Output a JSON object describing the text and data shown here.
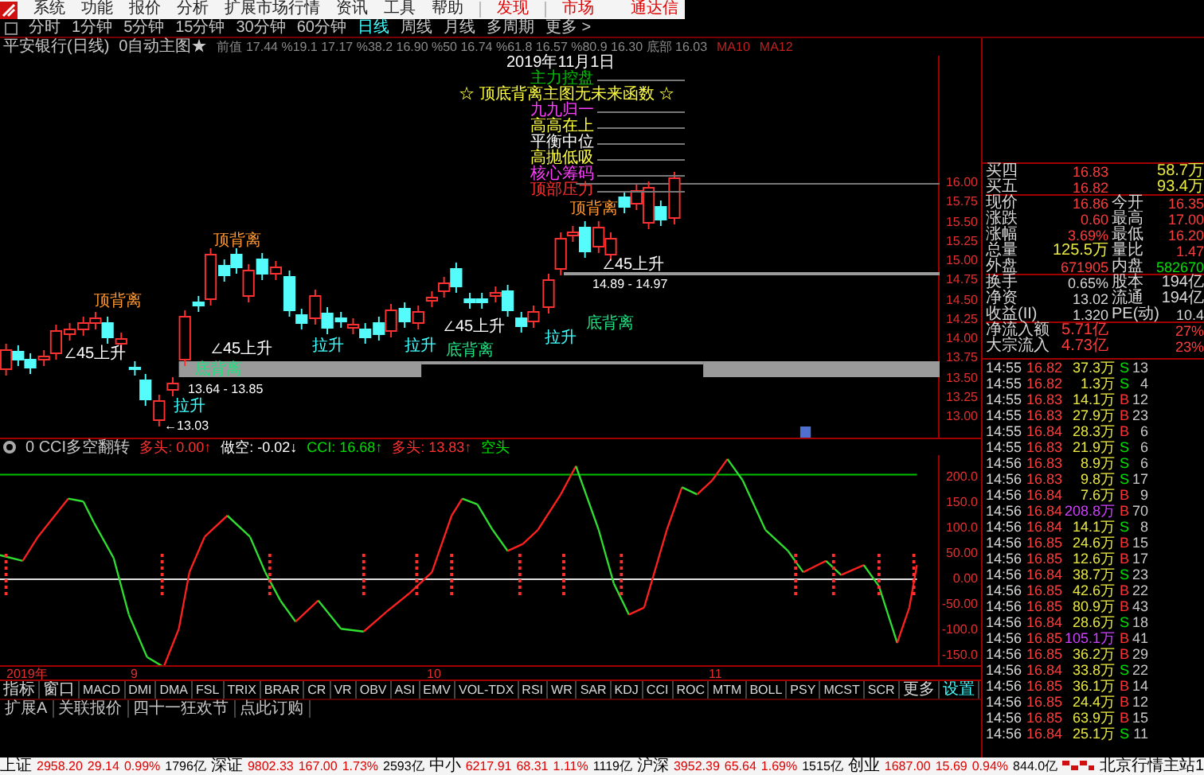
{
  "menu": {
    "items": [
      "系统",
      "功能",
      "报价",
      "分析",
      "扩展市场行情",
      "资讯",
      "工具",
      "帮助"
    ],
    "links": [
      "发现",
      "市场"
    ],
    "brand": "通达信"
  },
  "periods": [
    {
      "label": "分时",
      "selected": false
    },
    {
      "label": "1分钟",
      "selected": false
    },
    {
      "label": "5分钟",
      "selected": false
    },
    {
      "label": "15分钟",
      "selected": false
    },
    {
      "label": "30分钟",
      "selected": false
    },
    {
      "label": "60分钟",
      "selected": false
    },
    {
      "label": "日线",
      "selected": true
    },
    {
      "label": "周线",
      "selected": false
    },
    {
      "label": "月线",
      "selected": false
    },
    {
      "label": "多周期",
      "selected": false
    },
    {
      "label": "更多 >",
      "selected": false
    }
  ],
  "chart_header": {
    "title": "平安银行(日线)",
    "formula": "0自动主图★",
    "levels": "前值 17.44 %19.1 17.17 %38.2 16.90 %50 16.74 %61.8 16.57 %80.9 16.30 底部 16.03",
    "ma": [
      "MA10",
      "MA12"
    ]
  },
  "annotations": [
    {
      "text": "2019年11月1日",
      "color": "#ffffff"
    },
    {
      "text": "主力控盘",
      "color": "#00c000"
    },
    {
      "text": "☆ 顶底背离主图无未来函数 ☆",
      "color": "#ffff40"
    },
    {
      "text": "九九归一",
      "color": "#ff40ff"
    },
    {
      "text": "高高在上",
      "color": "#ffff40"
    },
    {
      "text": "平衡中位",
      "color": "#ffffff"
    },
    {
      "text": "高抛低吸",
      "color": "#ffff40"
    },
    {
      "text": "核心筹码",
      "color": "#ff40ff"
    },
    {
      "text": "顶部压力",
      "color": "#ff3030"
    }
  ],
  "chart_marks": [
    {
      "text": "顶背离",
      "kind": "top"
    },
    {
      "text": "顶背离",
      "kind": "top"
    },
    {
      "text": "顶背离",
      "kind": "top"
    },
    {
      "text": "∠45上升",
      "kind": "rise"
    },
    {
      "text": "∠45上升",
      "kind": "rise"
    },
    {
      "text": "∠45上升",
      "kind": "rise"
    },
    {
      "text": "∠45上升",
      "kind": "rise"
    },
    {
      "text": "拉升",
      "kind": "pull"
    },
    {
      "text": "拉升",
      "kind": "pull"
    },
    {
      "text": "拉升",
      "kind": "pull"
    },
    {
      "text": "拉升",
      "kind": "pull"
    },
    {
      "text": "底背离",
      "kind": "bottom"
    },
    {
      "text": "底背离",
      "kind": "bottom"
    },
    {
      "text": "底背离",
      "kind": "bottom"
    },
    {
      "text": "13.64 - 13.85",
      "kind": "price"
    },
    {
      "text": "←13.03",
      "kind": "price"
    },
    {
      "text": "14.89 - 14.97",
      "kind": "price"
    }
  ],
  "price_axis": [
    "16.00",
    "15.75",
    "15.50",
    "15.25",
    "15.00",
    "14.75",
    "14.50",
    "14.25",
    "14.00",
    "13.75",
    "13.50",
    "13.25",
    "13.00"
  ],
  "indicator": {
    "name": "0 CCI多空翻转",
    "values": [
      {
        "text": "多头: 0.00↑",
        "color": "#ff3030"
      },
      {
        "text": "做空: -0.02↓",
        "color": "#ffffff"
      },
      {
        "text": "CCI: 16.68↑",
        "color": "#00e000"
      },
      {
        "text": "多头: 13.83↑",
        "color": "#ff3030"
      },
      {
        "text": "空头",
        "color": "#00e000"
      }
    ]
  },
  "cci_axis": [
    "200.0",
    "150.0",
    "100.0",
    "50.00",
    "0.00",
    "-50.00",
    "-100.0",
    "-150.0"
  ],
  "date_axis": [
    "2019年",
    "9",
    "10",
    "11"
  ],
  "indicator_tabs": {
    "items": [
      "指标",
      "窗口",
      "MACD",
      "DMI",
      "DMA",
      "FSL",
      "TRIX",
      "BRAR",
      "CR",
      "VR",
      "OBV",
      "ASI",
      "EMV",
      "VOL-TDX",
      "RSI",
      "WR",
      "SAR",
      "KDJ",
      "CCI",
      "ROC",
      "MTM",
      "BOLL",
      "PSY",
      "MCST",
      "SCR",
      "更多"
    ],
    "settings": "设置"
  },
  "ext_bar": [
    "扩展A",
    "关联报价",
    "四十一狂欢节",
    "点此订购"
  ],
  "quote": [
    {
      "left": {
        "label": "买四",
        "value": "16.83",
        "color": "#ff3c3c"
      },
      "right": {
        "value": "58.7万",
        "color": "#e8e840"
      }
    },
    {
      "left": {
        "label": "买五",
        "value": "16.82",
        "color": "#ff3c3c"
      },
      "right": {
        "value": "93.4万",
        "color": "#e8e840"
      }
    },
    {
      "left": {
        "label": "现价",
        "value": "16.86",
        "color": "#ff3c3c"
      },
      "right": {
        "label": "今开",
        "value": "16.35",
        "color": "#ff3c3c"
      }
    },
    {
      "left": {
        "label": "涨跌",
        "value": "0.60",
        "color": "#ff3c3c"
      },
      "right": {
        "label": "最高",
        "value": "17.00",
        "color": "#ff3c3c"
      }
    },
    {
      "left": {
        "label": "涨幅",
        "value": "3.69%",
        "color": "#ff3c3c"
      },
      "right": {
        "label": "最低",
        "value": "16.20",
        "color": "#ff3c3c"
      }
    },
    {
      "left": {
        "label": "总量",
        "value": "125.5万",
        "color": "#e8e840"
      },
      "right": {
        "label": "量比",
        "value": "1.47",
        "color": "#ff3c3c"
      }
    },
    {
      "left": {
        "label": "外盘",
        "value": "671905",
        "color": "#ff3c3c"
      },
      "right": {
        "label": "内盘",
        "value": "582670",
        "color": "#00e000"
      }
    },
    {
      "left": {
        "label": "换手",
        "value": "0.65%",
        "color": "#d8d8d8"
      },
      "right": {
        "label": "股本",
        "value": "194亿",
        "color": "#d8d8d8"
      }
    },
    {
      "left": {
        "label": "净资",
        "value": "13.02",
        "color": "#d8d8d8"
      },
      "right": {
        "label": "流通",
        "value": "194亿",
        "color": "#d8d8d8"
      }
    },
    {
      "left": {
        "label": "收益(II)",
        "value": "1.320",
        "color": "#d8d8d8"
      },
      "right": {
        "label": "PE(动)",
        "value": "10.4",
        "color": "#d8d8d8"
      }
    },
    {
      "left": {
        "label": "净流入额",
        "value": "5.71亿",
        "color": "#ff3c3c"
      },
      "right": {
        "value": "27%",
        "color": "#ff3c3c"
      }
    },
    {
      "left": {
        "label": "大宗流入",
        "value": "4.73亿",
        "color": "#ff3c3c"
      },
      "right": {
        "value": "23%",
        "color": "#ff3c3c"
      }
    }
  ],
  "ticks": [
    {
      "time": "14:55",
      "price": "16.82",
      "volume": "37.3万",
      "side": "S",
      "count": "13",
      "big": false
    },
    {
      "time": "14:55",
      "price": "16.82",
      "volume": "1.3万",
      "side": "S",
      "count": "4",
      "big": false
    },
    {
      "time": "14:55",
      "price": "16.83",
      "volume": "14.1万",
      "side": "B",
      "count": "12",
      "big": false
    },
    {
      "time": "14:55",
      "price": "16.83",
      "volume": "27.9万",
      "side": "B",
      "count": "23",
      "big": false
    },
    {
      "time": "14:55",
      "price": "16.84",
      "volume": "28.3万",
      "side": "B",
      "count": "6",
      "big": false
    },
    {
      "time": "14:55",
      "price": "16.83",
      "volume": "21.9万",
      "side": "S",
      "count": "6",
      "big": false
    },
    {
      "time": "14:56",
      "price": "16.83",
      "volume": "8.9万",
      "side": "S",
      "count": "6",
      "big": false
    },
    {
      "time": "14:56",
      "price": "16.83",
      "volume": "9.8万",
      "side": "S",
      "count": "17",
      "big": false
    },
    {
      "time": "14:56",
      "price": "16.84",
      "volume": "7.6万",
      "side": "B",
      "count": "9",
      "big": false
    },
    {
      "time": "14:56",
      "price": "16.84",
      "volume": "208.8万",
      "side": "B",
      "count": "70",
      "big": true
    },
    {
      "time": "14:56",
      "price": "16.84",
      "volume": "14.1万",
      "side": "S",
      "count": "8",
      "big": false
    },
    {
      "time": "14:56",
      "price": "16.85",
      "volume": "24.6万",
      "side": "B",
      "count": "15",
      "big": false
    },
    {
      "time": "14:56",
      "price": "16.85",
      "volume": "12.6万",
      "side": "B",
      "count": "17",
      "big": false
    },
    {
      "time": "14:56",
      "price": "16.84",
      "volume": "38.7万",
      "side": "S",
      "count": "23",
      "big": false
    },
    {
      "time": "14:56",
      "price": "16.85",
      "volume": "42.6万",
      "side": "B",
      "count": "22",
      "big": false
    },
    {
      "time": "14:56",
      "price": "16.85",
      "volume": "80.9万",
      "side": "B",
      "count": "43",
      "big": false
    },
    {
      "time": "14:56",
      "price": "16.84",
      "volume": "28.6万",
      "side": "S",
      "count": "18",
      "big": false
    },
    {
      "time": "14:56",
      "price": "16.85",
      "volume": "105.1万",
      "side": "B",
      "count": "41",
      "big": true
    },
    {
      "time": "14:56",
      "price": "16.85",
      "volume": "36.2万",
      "side": "B",
      "count": "29",
      "big": false
    },
    {
      "time": "14:56",
      "price": "16.84",
      "volume": "33.8万",
      "side": "S",
      "count": "22",
      "big": false
    },
    {
      "time": "14:56",
      "price": "16.85",
      "volume": "36.1万",
      "side": "B",
      "count": "14",
      "big": false
    },
    {
      "time": "14:56",
      "price": "16.85",
      "volume": "24.4万",
      "side": "B",
      "count": "12",
      "big": false
    },
    {
      "time": "14:56",
      "price": "16.85",
      "volume": "63.9万",
      "side": "B",
      "count": "15",
      "big": false
    },
    {
      "time": "14:56",
      "price": "16.84",
      "volume": "25.1万",
      "side": "S",
      "count": "11",
      "big": false
    }
  ],
  "status_bar": {
    "indices": [
      {
        "name": "上证",
        "value": "2958.20",
        "change": "29.14",
        "percent": "0.99%",
        "amount": "1796亿"
      },
      {
        "name": "深证",
        "value": "9802.33",
        "change": "167.00",
        "percent": "1.73%",
        "amount": "2593亿"
      },
      {
        "name": "中小",
        "value": "6217.91",
        "change": "68.31",
        "percent": "1.11%",
        "amount": "1119亿"
      },
      {
        "name": "沪深",
        "value": "3952.39",
        "change": "65.64",
        "percent": "1.69%",
        "amount": "1515亿"
      },
      {
        "name": "创业",
        "value": "1687.00",
        "change": "15.69",
        "percent": "0.94%",
        "amount": "844.0亿"
      }
    ],
    "server": "北京行情主站1"
  }
}
